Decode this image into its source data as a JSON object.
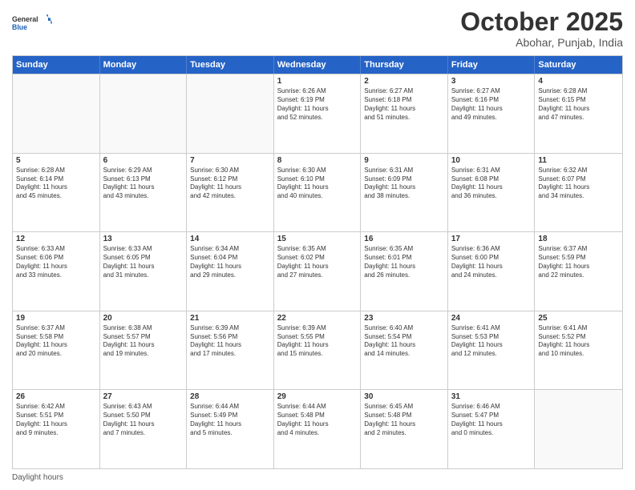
{
  "header": {
    "logo_general": "General",
    "logo_blue": "Blue",
    "month_title": "October 2025",
    "subtitle": "Abohar, Punjab, India"
  },
  "calendar": {
    "days_of_week": [
      "Sunday",
      "Monday",
      "Tuesday",
      "Wednesday",
      "Thursday",
      "Friday",
      "Saturday"
    ],
    "rows": [
      [
        {
          "day": "",
          "empty": true
        },
        {
          "day": "",
          "empty": true
        },
        {
          "day": "",
          "empty": true
        },
        {
          "day": "1",
          "lines": [
            "Sunrise: 6:26 AM",
            "Sunset: 6:19 PM",
            "Daylight: 11 hours",
            "and 52 minutes."
          ]
        },
        {
          "day": "2",
          "lines": [
            "Sunrise: 6:27 AM",
            "Sunset: 6:18 PM",
            "Daylight: 11 hours",
            "and 51 minutes."
          ]
        },
        {
          "day": "3",
          "lines": [
            "Sunrise: 6:27 AM",
            "Sunset: 6:16 PM",
            "Daylight: 11 hours",
            "and 49 minutes."
          ]
        },
        {
          "day": "4",
          "lines": [
            "Sunrise: 6:28 AM",
            "Sunset: 6:15 PM",
            "Daylight: 11 hours",
            "and 47 minutes."
          ]
        }
      ],
      [
        {
          "day": "5",
          "lines": [
            "Sunrise: 6:28 AM",
            "Sunset: 6:14 PM",
            "Daylight: 11 hours",
            "and 45 minutes."
          ]
        },
        {
          "day": "6",
          "lines": [
            "Sunrise: 6:29 AM",
            "Sunset: 6:13 PM",
            "Daylight: 11 hours",
            "and 43 minutes."
          ]
        },
        {
          "day": "7",
          "lines": [
            "Sunrise: 6:30 AM",
            "Sunset: 6:12 PM",
            "Daylight: 11 hours",
            "and 42 minutes."
          ]
        },
        {
          "day": "8",
          "lines": [
            "Sunrise: 6:30 AM",
            "Sunset: 6:10 PM",
            "Daylight: 11 hours",
            "and 40 minutes."
          ]
        },
        {
          "day": "9",
          "lines": [
            "Sunrise: 6:31 AM",
            "Sunset: 6:09 PM",
            "Daylight: 11 hours",
            "and 38 minutes."
          ]
        },
        {
          "day": "10",
          "lines": [
            "Sunrise: 6:31 AM",
            "Sunset: 6:08 PM",
            "Daylight: 11 hours",
            "and 36 minutes."
          ]
        },
        {
          "day": "11",
          "lines": [
            "Sunrise: 6:32 AM",
            "Sunset: 6:07 PM",
            "Daylight: 11 hours",
            "and 34 minutes."
          ]
        }
      ],
      [
        {
          "day": "12",
          "lines": [
            "Sunrise: 6:33 AM",
            "Sunset: 6:06 PM",
            "Daylight: 11 hours",
            "and 33 minutes."
          ]
        },
        {
          "day": "13",
          "lines": [
            "Sunrise: 6:33 AM",
            "Sunset: 6:05 PM",
            "Daylight: 11 hours",
            "and 31 minutes."
          ]
        },
        {
          "day": "14",
          "lines": [
            "Sunrise: 6:34 AM",
            "Sunset: 6:04 PM",
            "Daylight: 11 hours",
            "and 29 minutes."
          ]
        },
        {
          "day": "15",
          "lines": [
            "Sunrise: 6:35 AM",
            "Sunset: 6:02 PM",
            "Daylight: 11 hours",
            "and 27 minutes."
          ]
        },
        {
          "day": "16",
          "lines": [
            "Sunrise: 6:35 AM",
            "Sunset: 6:01 PM",
            "Daylight: 11 hours",
            "and 26 minutes."
          ]
        },
        {
          "day": "17",
          "lines": [
            "Sunrise: 6:36 AM",
            "Sunset: 6:00 PM",
            "Daylight: 11 hours",
            "and 24 minutes."
          ]
        },
        {
          "day": "18",
          "lines": [
            "Sunrise: 6:37 AM",
            "Sunset: 5:59 PM",
            "Daylight: 11 hours",
            "and 22 minutes."
          ]
        }
      ],
      [
        {
          "day": "19",
          "lines": [
            "Sunrise: 6:37 AM",
            "Sunset: 5:58 PM",
            "Daylight: 11 hours",
            "and 20 minutes."
          ]
        },
        {
          "day": "20",
          "lines": [
            "Sunrise: 6:38 AM",
            "Sunset: 5:57 PM",
            "Daylight: 11 hours",
            "and 19 minutes."
          ]
        },
        {
          "day": "21",
          "lines": [
            "Sunrise: 6:39 AM",
            "Sunset: 5:56 PM",
            "Daylight: 11 hours",
            "and 17 minutes."
          ]
        },
        {
          "day": "22",
          "lines": [
            "Sunrise: 6:39 AM",
            "Sunset: 5:55 PM",
            "Daylight: 11 hours",
            "and 15 minutes."
          ]
        },
        {
          "day": "23",
          "lines": [
            "Sunrise: 6:40 AM",
            "Sunset: 5:54 PM",
            "Daylight: 11 hours",
            "and 14 minutes."
          ]
        },
        {
          "day": "24",
          "lines": [
            "Sunrise: 6:41 AM",
            "Sunset: 5:53 PM",
            "Daylight: 11 hours",
            "and 12 minutes."
          ]
        },
        {
          "day": "25",
          "lines": [
            "Sunrise: 6:41 AM",
            "Sunset: 5:52 PM",
            "Daylight: 11 hours",
            "and 10 minutes."
          ]
        }
      ],
      [
        {
          "day": "26",
          "lines": [
            "Sunrise: 6:42 AM",
            "Sunset: 5:51 PM",
            "Daylight: 11 hours",
            "and 9 minutes."
          ]
        },
        {
          "day": "27",
          "lines": [
            "Sunrise: 6:43 AM",
            "Sunset: 5:50 PM",
            "Daylight: 11 hours",
            "and 7 minutes."
          ]
        },
        {
          "day": "28",
          "lines": [
            "Sunrise: 6:44 AM",
            "Sunset: 5:49 PM",
            "Daylight: 11 hours",
            "and 5 minutes."
          ]
        },
        {
          "day": "29",
          "lines": [
            "Sunrise: 6:44 AM",
            "Sunset: 5:48 PM",
            "Daylight: 11 hours",
            "and 4 minutes."
          ]
        },
        {
          "day": "30",
          "lines": [
            "Sunrise: 6:45 AM",
            "Sunset: 5:48 PM",
            "Daylight: 11 hours",
            "and 2 minutes."
          ]
        },
        {
          "day": "31",
          "lines": [
            "Sunrise: 6:46 AM",
            "Sunset: 5:47 PM",
            "Daylight: 11 hours",
            "and 0 minutes."
          ]
        },
        {
          "day": "",
          "empty": true
        }
      ]
    ]
  },
  "footer": {
    "daylight_hours": "Daylight hours"
  }
}
